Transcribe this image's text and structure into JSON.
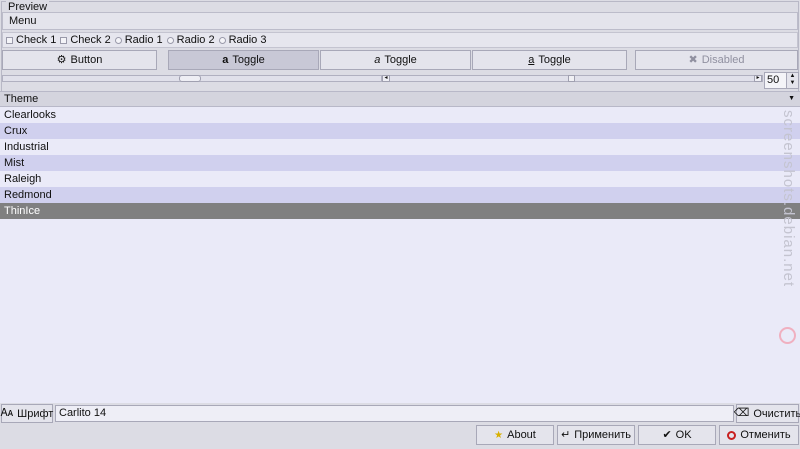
{
  "preview": {
    "frame_label": "Preview",
    "menu_label": "Menu",
    "checks": [
      "Check 1",
      "Check 2"
    ],
    "radios": [
      "Radio 1",
      "Radio 2",
      "Radio 3"
    ]
  },
  "buttons": {
    "button_label": "Button",
    "toggle_labels": [
      "Toggle",
      "Toggle",
      "Toggle"
    ],
    "toggle_glyph": "a",
    "disabled_label": "Disabled"
  },
  "spin": {
    "value": "50"
  },
  "slider": {
    "level": 0.48
  },
  "theme": {
    "header": "Theme",
    "items": [
      "Clearlooks",
      "Crux",
      "Industrial",
      "Mist",
      "Raleigh",
      "Redmond",
      "ThinIce"
    ],
    "selected": "ThinIce"
  },
  "font": {
    "button_label": "Шрифт",
    "value": "Carlito 14",
    "clear_label": "Очистить"
  },
  "dialog_buttons": {
    "about": "About",
    "apply": "Применить",
    "ok": "OK",
    "cancel": "Отменить"
  },
  "watermark": "screenshots.debian.net",
  "colors": {
    "selection": "#808080",
    "row_alt": "#d0d0ee",
    "row_bg": "#eaeaf8"
  }
}
